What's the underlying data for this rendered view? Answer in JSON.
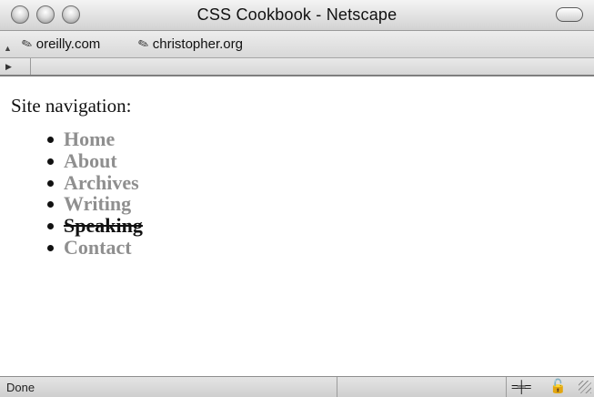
{
  "window": {
    "title": "CSS Cookbook - Netscape"
  },
  "bookmarks": [
    {
      "label": "oreilly.com",
      "icon": "bookmark-icon"
    },
    {
      "label": "christopher.org",
      "icon": "bookmark-icon"
    }
  ],
  "content": {
    "heading": "Site navigation:",
    "nav_items": [
      {
        "label": "Home",
        "current": false
      },
      {
        "label": "About",
        "current": false
      },
      {
        "label": "Archives",
        "current": false
      },
      {
        "label": "Writing",
        "current": false
      },
      {
        "label": "Speaking",
        "current": true
      },
      {
        "label": "Contact",
        "current": false
      }
    ],
    "link_color": "#8f8f8f",
    "current_color": "#111111"
  },
  "status": {
    "text": "Done"
  }
}
